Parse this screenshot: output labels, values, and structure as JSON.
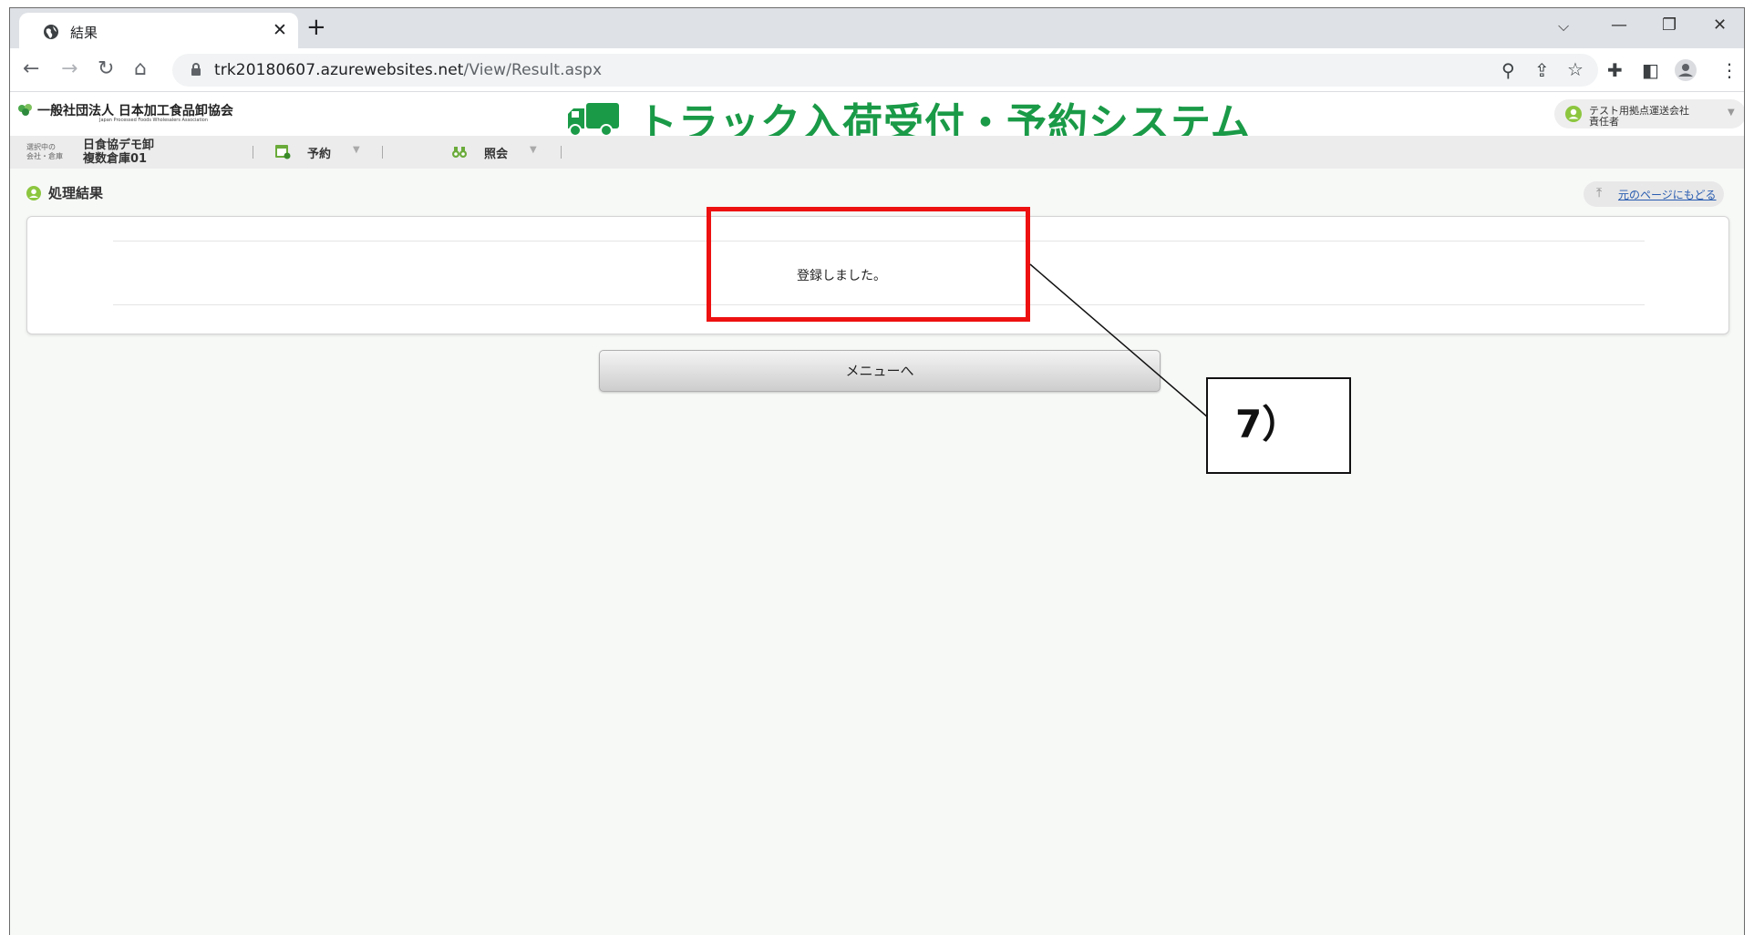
{
  "browser": {
    "tab_title": "結果",
    "tab_close": "✕",
    "new_tab": "+",
    "url_host": "trk20180607.azurewebsites.net",
    "url_path": "/View/Result.aspx"
  },
  "header": {
    "org_name": "一般社団法人 日本加工食品卸協会",
    "org_name_en": "Japan Processed Foods Wholesalers Association",
    "system_title": "トラック入荷受付・予約システム",
    "user_company": "テスト用拠点運送会社",
    "user_role": "責任者"
  },
  "nav": {
    "selected_label_1": "選択中の",
    "selected_label_2": "会社・倉庫",
    "selected_company": "日食協デモ卸",
    "selected_warehouse": "複数倉庫01",
    "menu_reservation": "予約",
    "menu_inquiry": "照会"
  },
  "main": {
    "page_title": "処理結果",
    "back_link": "元のページにもどる",
    "result_message": "登録しました。",
    "menu_button": "メニューへ"
  },
  "annotation": {
    "label": "7）",
    "highlight_color": "#ee1111"
  },
  "colors": {
    "brand_green": "#1a9a47"
  }
}
